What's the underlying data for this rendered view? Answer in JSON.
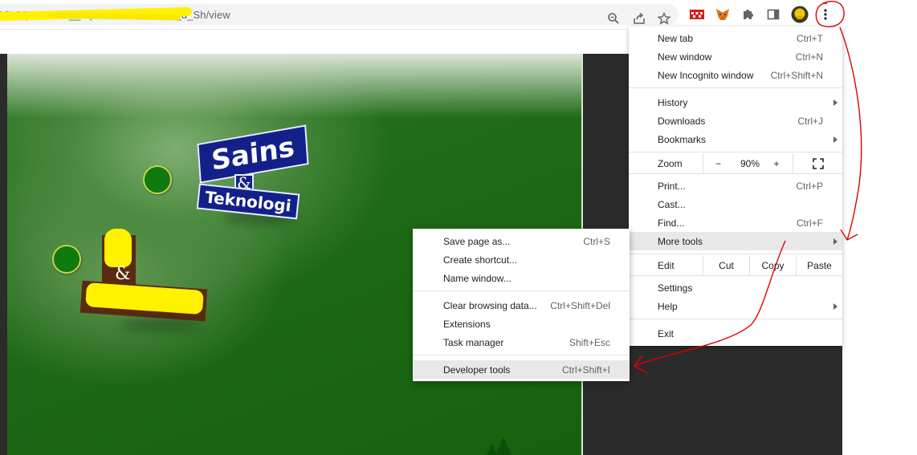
{
  "address_bar": {
    "url_visible": "YiL2QIaJSfWh__kq1e1AC99PBPT86_d_Sh/view"
  },
  "toolbar_icons": [
    "zoom-icon",
    "share-icon",
    "bookmark-star-icon",
    "extension-red-icon",
    "metamask-fox-icon",
    "puzzle-extensions-icon",
    "side-panel-icon",
    "profile-avatar-icon",
    "kebab-menu-icon"
  ],
  "page": {
    "logo_line1": "Sains",
    "logo_amp": "&",
    "logo_line2": "Teknologi",
    "left_amp": "&"
  },
  "menu": {
    "new_tab": {
      "label": "New tab",
      "shortcut": "Ctrl+T"
    },
    "new_window": {
      "label": "New window",
      "shortcut": "Ctrl+N"
    },
    "incognito": {
      "label": "New Incognito window",
      "shortcut": "Ctrl+Shift+N"
    },
    "history": {
      "label": "History"
    },
    "downloads": {
      "label": "Downloads",
      "shortcut": "Ctrl+J"
    },
    "bookmarks": {
      "label": "Bookmarks"
    },
    "zoom": {
      "label": "Zoom",
      "minus": "−",
      "value": "90%",
      "plus": "+"
    },
    "print": {
      "label": "Print...",
      "shortcut": "Ctrl+P"
    },
    "cast": {
      "label": "Cast..."
    },
    "find": {
      "label": "Find...",
      "shortcut": "Ctrl+F"
    },
    "more_tools": {
      "label": "More tools"
    },
    "edit": {
      "label": "Edit",
      "cut": "Cut",
      "copy": "Copy",
      "paste": "Paste"
    },
    "settings": {
      "label": "Settings"
    },
    "help": {
      "label": "Help"
    },
    "exit": {
      "label": "Exit"
    }
  },
  "submenu": {
    "save_page": {
      "label": "Save page as...",
      "shortcut": "Ctrl+S"
    },
    "create_shortcut": {
      "label": "Create shortcut..."
    },
    "name_window": {
      "label": "Name window..."
    },
    "clear_browsing": {
      "label": "Clear browsing data...",
      "shortcut": "Ctrl+Shift+Del"
    },
    "extensions": {
      "label": "Extensions"
    },
    "task_manager": {
      "label": "Task manager",
      "shortcut": "Shift+Esc"
    },
    "developer_tools": {
      "label": "Developer tools",
      "shortcut": "Ctrl+Shift+I"
    }
  },
  "colors": {
    "annotation_red": "#e00000",
    "highlighter_yellow": "#fff200",
    "menu_highlight": "#e8e8e8",
    "scene_green": "#1f6b18"
  }
}
